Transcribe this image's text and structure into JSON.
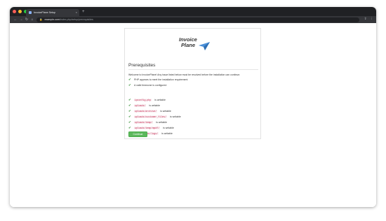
{
  "browser": {
    "tab_title": "InvoicePlane Setup",
    "tab_close": "×",
    "new_tab": "+",
    "url_host": "example.com",
    "url_path": "/index.php/setup/prerequisites",
    "traffic_colors": [
      "#ff5f57",
      "#febc2e",
      "#28c840"
    ],
    "nav": {
      "back": "←",
      "forward": "→",
      "reload": "↻",
      "home": "⌂"
    },
    "lock_icon": "🔒",
    "right_icons": {
      "share": "⇪",
      "menu": "⋮"
    }
  },
  "logo": {
    "line1": "Invoice",
    "line2": "Plane",
    "mark_color": "#4a90d9"
  },
  "page": {
    "title": "Prerequisites",
    "intro": "Welcome to InvoicePlane! Any issue listed below must be resolved before the installation can continue.",
    "basic_checks": [
      {
        "text": "PHP appears to meet the installation requirement"
      },
      {
        "text": "A valid timezone is configured"
      }
    ],
    "writable_checks": [
      {
        "code": "ipconfig.php",
        "text": "is writable"
      },
      {
        "code": "uploads/",
        "text": "is writable"
      },
      {
        "code": "uploads/archive/",
        "text": "is writable"
      },
      {
        "code": "uploads/customer_files/",
        "text": "is writable"
      },
      {
        "code": "uploads/temp/",
        "text": "is writable"
      },
      {
        "code": "uploads/temp/mpdf/",
        "text": "is writable"
      },
      {
        "code": "application/logs/",
        "text": "is writable"
      }
    ],
    "check_mark": "✔",
    "check_color": "#2b8a2b",
    "continue_label": "Continue",
    "button_color": "#5cb85c"
  }
}
